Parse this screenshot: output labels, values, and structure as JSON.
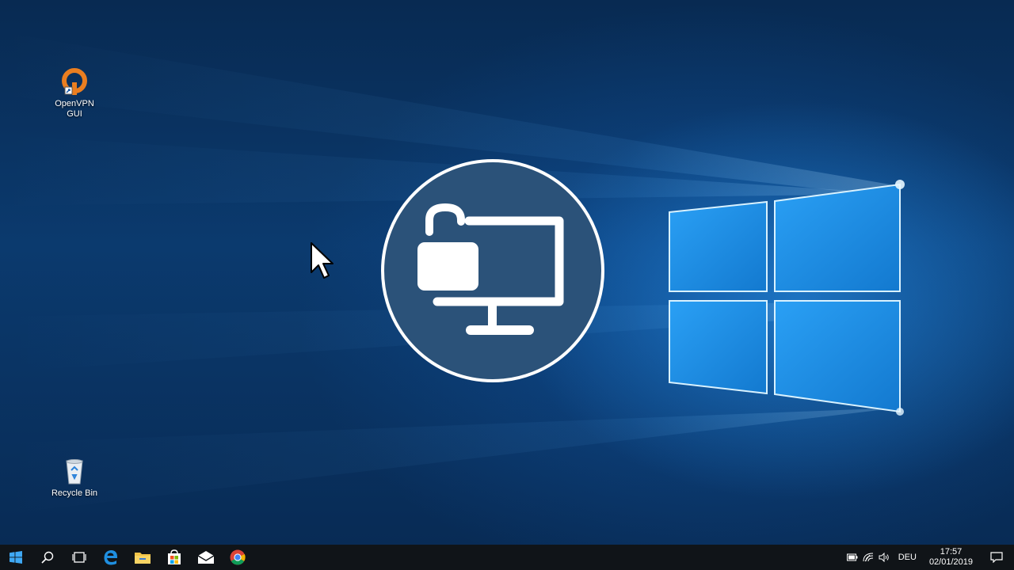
{
  "desktop": {
    "icons": [
      {
        "name": "openvpn-gui-shortcut",
        "label_line1": "OpenVPN",
        "label_line2": "GUI",
        "icon": "openvpn-icon"
      },
      {
        "name": "recycle-bin",
        "label": "Recycle Bin",
        "icon": "recycle-bin-icon"
      }
    ],
    "overlay_logo": "lock-monitor-icon"
  },
  "taskbar": {
    "start": "windows-start-icon",
    "pinned": [
      "search-icon",
      "task-view-icon",
      "edge-icon",
      "file-explorer-icon",
      "store-icon",
      "mail-icon",
      "chrome-icon"
    ],
    "tray": {
      "icons": [
        "battery-icon",
        "network-icon",
        "volume-icon"
      ],
      "language": "DEU",
      "time": "17:57",
      "date": "02/01/2019",
      "notification": "action-center-icon"
    }
  },
  "colors": {
    "accent": "#0a78d7",
    "logo_fill": "#2b5279",
    "openvpn_orange": "#ea7e20",
    "taskbar": "#101418"
  }
}
